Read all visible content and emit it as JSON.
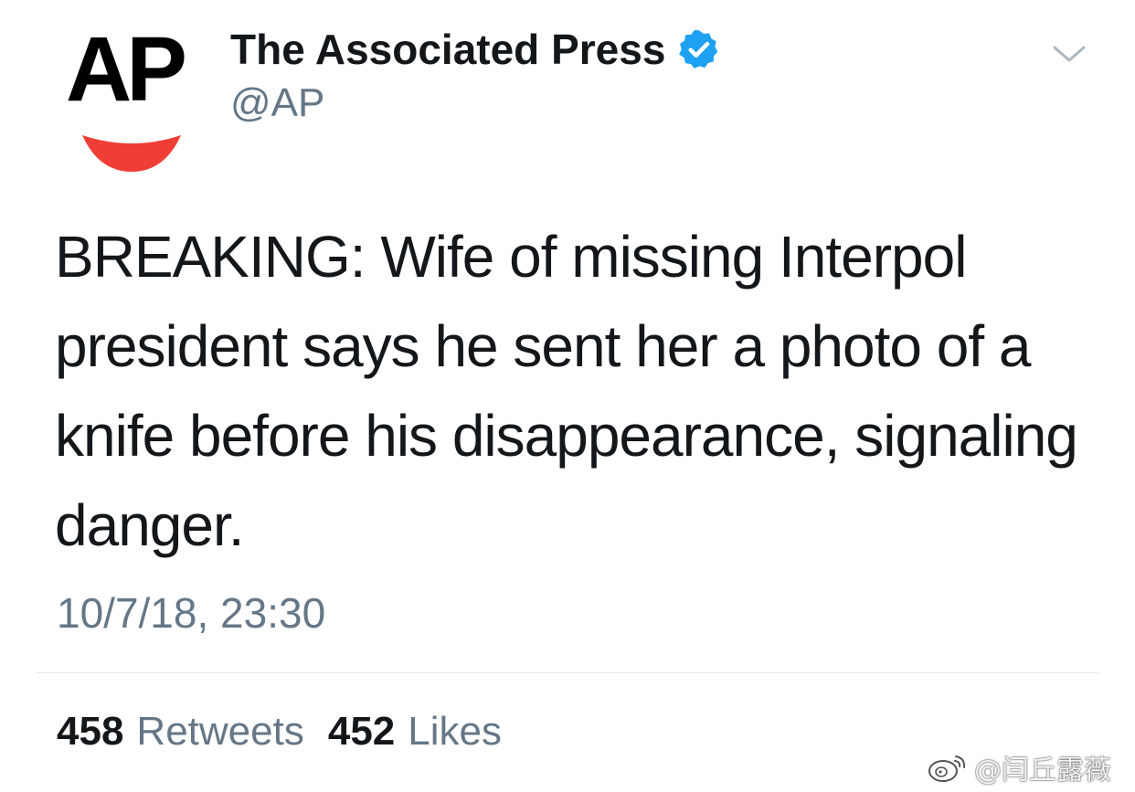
{
  "account": {
    "avatar_letters": "AP",
    "display_name": "The Associated Press",
    "handle": "@AP",
    "verified": true,
    "brand_color": "#ef3e36",
    "verified_color": "#1da1f2"
  },
  "header": {
    "menu_icon": "chevron-down-icon"
  },
  "tweet": {
    "text": "BREAKING: Wife of missing Interpol president says he sent her a photo of a knife before his disappearance, signaling danger.",
    "timestamp": "10/7/18, 23:30"
  },
  "stats": {
    "retweets_count": "458",
    "retweets_label": "Retweets",
    "likes_count": "452",
    "likes_label": "Likes"
  },
  "watermark": {
    "icon": "weibo-icon",
    "text": "@闫丘露薇"
  }
}
